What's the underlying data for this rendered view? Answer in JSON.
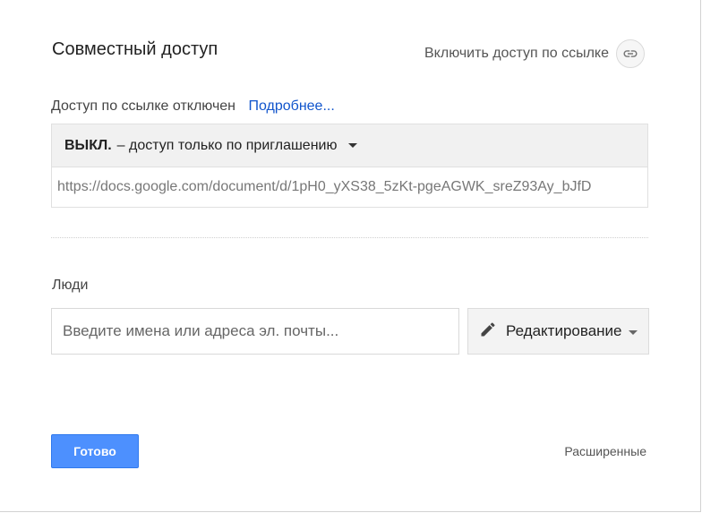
{
  "dialog": {
    "title": "Совместный доступ",
    "link_toggle_label": "Включить доступ по ссылке",
    "link_toggle_icon": "link-icon"
  },
  "link_access": {
    "status_text": "Доступ по ссылке отключен",
    "more_link": "Подробнее...",
    "dropdown_bold": "ВЫКЛ.",
    "dropdown_text": "– доступ только по приглашению",
    "url_value": "https://docs.google.com/document/d/1pH0_yXS38_5zKt-pgeAGWK_sreZ93Ay_bJfD"
  },
  "people": {
    "label": "Люди",
    "input_placeholder": "Введите имена или адреса эл. почты...",
    "permission_icon": "pencil-icon",
    "permission_label": "Редактирование"
  },
  "footer": {
    "done_label": "Готово",
    "advanced_label": "Расширенные"
  },
  "colors": {
    "primary_button": "#4d90fe",
    "link": "#1155cc"
  }
}
